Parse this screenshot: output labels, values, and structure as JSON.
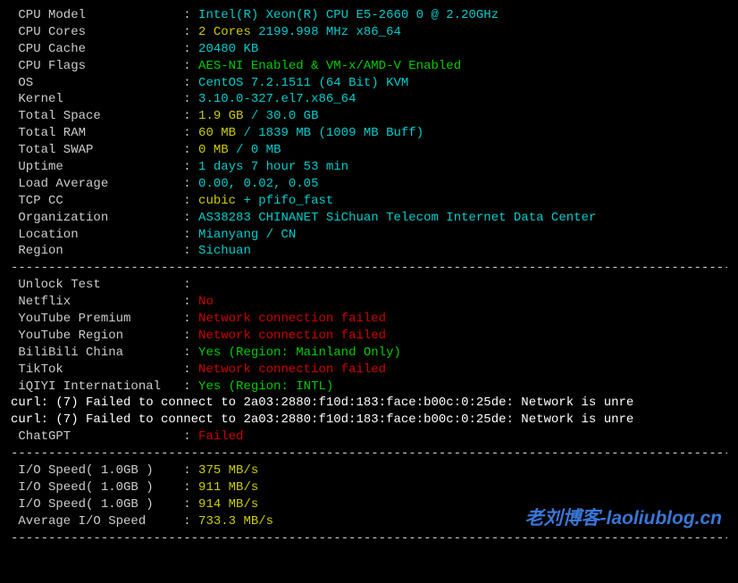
{
  "sysinfo": [
    {
      "label": "CPU Model",
      "value": "Intel(R) Xeon(R) CPU E5-2660 0 @ 2.20GHz",
      "cls": "cyan"
    },
    {
      "label": "CPU Cores",
      "prefix": "2 Cores",
      "prefix_cls": "yellow",
      "value": " 2199.998 MHz x86_64",
      "cls": "cyan"
    },
    {
      "label": "CPU Cache",
      "value": "20480 KB",
      "cls": "cyan"
    },
    {
      "label": "CPU Flags",
      "value": "AES-NI Enabled & VM-x/AMD-V Enabled",
      "cls": "green"
    },
    {
      "label": "OS",
      "value": "CentOS 7.2.1511 (64 Bit) KVM",
      "cls": "cyan"
    },
    {
      "label": "Kernel",
      "value": "3.10.0-327.el7.x86_64",
      "cls": "cyan"
    },
    {
      "label": "Total Space",
      "prefix": "1.9 GB",
      "prefix_cls": "yellow",
      "value": " / 30.0 GB",
      "cls": "cyan"
    },
    {
      "label": "Total RAM",
      "prefix": "60 MB",
      "prefix_cls": "yellow",
      "value": " / 1839 MB (1009 MB Buff)",
      "cls": "cyan"
    },
    {
      "label": "Total SWAP",
      "prefix": "0 MB",
      "prefix_cls": "yellow",
      "value": " / 0 MB",
      "cls": "cyan"
    },
    {
      "label": "Uptime",
      "value": "1 days 7 hour 53 min",
      "cls": "cyan"
    },
    {
      "label": "Load Average",
      "value": "0.00, 0.02, 0.05",
      "cls": "cyan"
    },
    {
      "label": "TCP CC",
      "prefix": "cubic",
      "prefix_cls": "yellow",
      "value": " + pfifo_fast",
      "cls": "cyan"
    },
    {
      "label": "Organization",
      "value": "AS38283 CHINANET SiChuan Telecom Internet Data Center",
      "cls": "cyan"
    },
    {
      "label": "Location",
      "value": "Mianyang / CN",
      "cls": "cyan"
    },
    {
      "label": "Region",
      "value": "Sichuan",
      "cls": "cyan"
    }
  ],
  "unlock_header": {
    "label": "Unlock Test",
    "value": ""
  },
  "unlock": [
    {
      "label": "Netflix",
      "value": "No",
      "cls": "red"
    },
    {
      "label": "YouTube Premium",
      "value": "Network connection failed",
      "cls": "red"
    },
    {
      "label": "YouTube Region",
      "value": "Network connection failed",
      "cls": "red"
    },
    {
      "label": "BiliBili China",
      "value": "Yes (Region: Mainland Only)",
      "cls": "green"
    },
    {
      "label": "TikTok",
      "value": "Network connection failed",
      "cls": "red"
    },
    {
      "label": "iQIYI International",
      "value": "Yes (Region: INTL)",
      "cls": "green"
    }
  ],
  "curl_errors": [
    "curl: (7) Failed to connect to 2a03:2880:f10d:183:face:b00c:0:25de: Network is unre",
    "curl: (7) Failed to connect to 2a03:2880:f10d:183:face:b00c:0:25de: Network is unre"
  ],
  "chatgpt": {
    "label": "ChatGPT",
    "value": "Failed",
    "cls": "red"
  },
  "io": [
    {
      "label": "I/O Speed( 1.0GB )",
      "value": "375 MB/s",
      "cls": "yellow"
    },
    {
      "label": "I/O Speed( 1.0GB )",
      "value": "911 MB/s",
      "cls": "yellow"
    },
    {
      "label": "I/O Speed( 1.0GB )",
      "value": "914 MB/s",
      "cls": "yellow"
    },
    {
      "label": "Average I/O Speed",
      "value": "733.3 MB/s",
      "cls": "yellow"
    }
  ],
  "dashes": "----------------------------------------------------------------------------------------------------",
  "watermark": "老刘博客-laoliublog.cn"
}
